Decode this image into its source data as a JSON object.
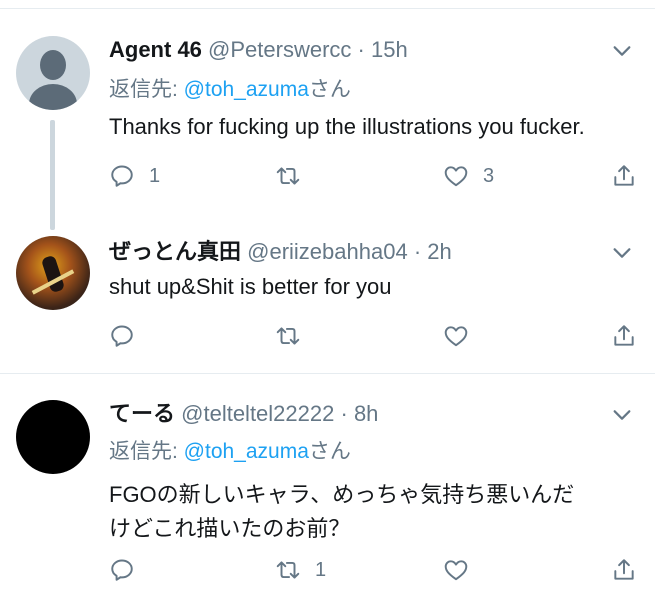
{
  "colors": {
    "text": "#14171a",
    "secondary": "#657786",
    "link": "#1da1f2",
    "divider": "#e6ecf0",
    "thread_line": "#ccd6dd"
  },
  "tweets": [
    {
      "display_name": "Agent 46",
      "handle": "@Peterswercc",
      "dot": "·",
      "time": "15h",
      "reply_prefix": "返信先: ",
      "reply_mention": "@toh_azuma",
      "reply_suffix": "さん",
      "text_lines": [
        "Thanks for fucking up the illustrations you fucker."
      ],
      "reply_count": "1",
      "retweet_count": "",
      "like_count": "3"
    },
    {
      "display_name": "ぜっとん真田",
      "handle": "@eriizebahha04",
      "dot": "·",
      "time": "2h",
      "text_lines": [
        "shut up&Shit is better for you"
      ],
      "reply_count": "",
      "retweet_count": "",
      "like_count": ""
    },
    {
      "display_name": "てーる",
      "handle": "@telteltel22222",
      "dot": "·",
      "time": "8h",
      "reply_prefix": "返信先: ",
      "reply_mention": "@toh_azuma",
      "reply_suffix": "さん",
      "text_lines": [
        "FGOの新しいキャラ、めっちゃ気持ち悪いんだ",
        "けどこれ描いたのお前？"
      ],
      "reply_count": "",
      "retweet_count": "1",
      "like_count": ""
    }
  ],
  "icons": [
    "reply-icon",
    "retweet-icon",
    "like-icon",
    "share-icon",
    "chevron-down-icon"
  ]
}
